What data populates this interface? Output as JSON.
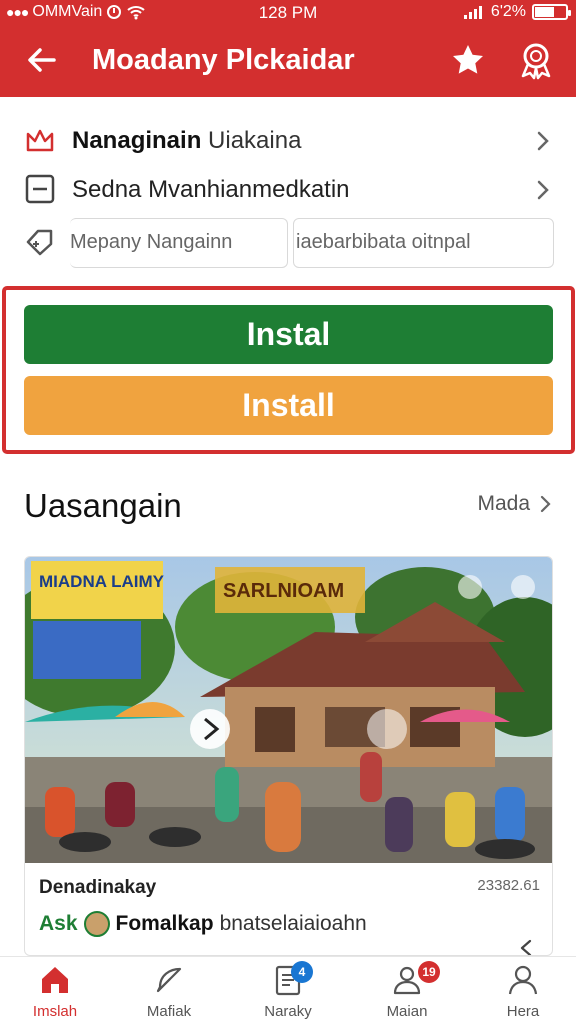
{
  "status_bar": {
    "carrier": "OMMVain",
    "time": "128 PM",
    "battery": "6'2%",
    "battery_level": 0.62
  },
  "header": {
    "title": "Moadany Plckaidar",
    "back_icon": "arrow-left-icon",
    "star_icon": "star-icon",
    "badge_icon": "award-badge-icon"
  },
  "info": {
    "row1_bold": "Nanaginain",
    "row1_light": "Uiakaina",
    "row2": "Sedna Mvanhianmedkatin",
    "field_a": "Mepany Nangainn",
    "field_b": "iaebarbibata oitnpal"
  },
  "install": {
    "primary_label": "Instal",
    "secondary_label": "Install",
    "primary_color": "#1e7e34",
    "secondary_color": "#f0a33f"
  },
  "section": {
    "title": "Uasangain",
    "more_label": "Mada"
  },
  "card": {
    "photo_sign_left": "MIADNA LAIMY",
    "photo_sign_center": "SARLNIOAM",
    "meta": "Denadinakay",
    "date": "23382.61",
    "ask_label": "Ask",
    "name": "Fomalkap",
    "text": "bnatselaiaioahn"
  },
  "nav": {
    "items": [
      {
        "label": "Imslah",
        "icon": "home-icon",
        "active": true
      },
      {
        "label": "Mafiak",
        "icon": "feather-icon"
      },
      {
        "label": "Naraky",
        "icon": "document-icon",
        "badge": "4"
      },
      {
        "label": "Maian",
        "icon": "group-icon",
        "badge": "19"
      },
      {
        "label": "Hera",
        "icon": "profile-icon"
      }
    ]
  },
  "colors": {
    "brand_red": "#d32f2f",
    "green": "#1e7e34",
    "orange": "#f0a33f",
    "badge_blue": "#1976d2",
    "badge_red": "#d32f2f"
  }
}
